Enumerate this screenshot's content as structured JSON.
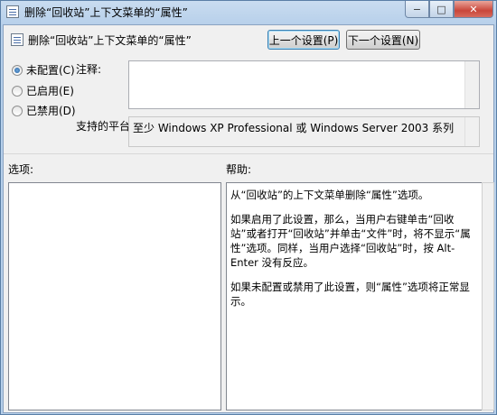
{
  "window": {
    "title": "删除“回收站”上下文菜单的“属性”",
    "caption_buttons": {
      "minimize": "−",
      "maximize": "□",
      "close": "✕"
    }
  },
  "header": {
    "policy_title": "删除“回收站”上下文菜单的“属性”",
    "prev_button": "上一个设置(P)",
    "next_button": "下一个设置(N)"
  },
  "state": {
    "options": [
      {
        "label": "未配置(C)",
        "checked": true
      },
      {
        "label": "已启用(E)",
        "checked": false
      },
      {
        "label": "已禁用(D)",
        "checked": false
      }
    ]
  },
  "comment": {
    "label": "注释:",
    "value": ""
  },
  "supported": {
    "label": "支持的平台:",
    "value": "至少 Windows XP Professional 或 Windows Server 2003 系列"
  },
  "options_section": {
    "label": "选项:"
  },
  "help_section": {
    "label": "帮助:",
    "paragraphs": [
      "从“回收站”的上下文菜单删除“属性”选项。",
      "如果启用了此设置，那么，当用户右键单击“回收站”或者打开“回收站”并单击“文件”时，将不显示“属性”选项。同样，当用户选择“回收站”时，按 Alt-Enter 没有反应。",
      "如果未配置或禁用了此设置，则“属性”选项将正常显示。"
    ]
  },
  "colors": {
    "title_bar": "#b6cfea",
    "client_bg": "#f0f0f0",
    "close_button": "#c9463a"
  }
}
